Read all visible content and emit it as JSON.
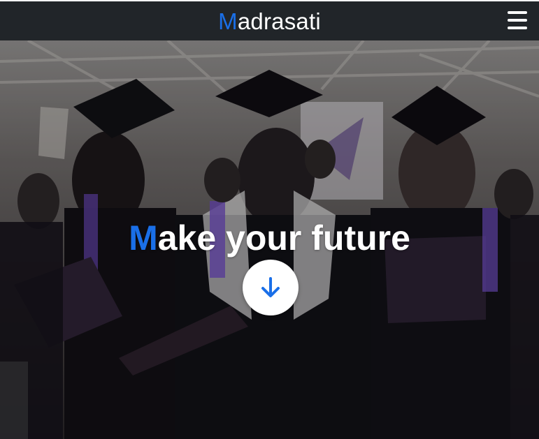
{
  "navbar": {
    "brand_initial": "M",
    "brand_rest": "adrasati",
    "menu_icon": "hamburger-menu-icon"
  },
  "hero": {
    "title_initial": "M",
    "title_rest": "ake your future",
    "scroll_icon": "arrow-down-icon"
  },
  "colors": {
    "accent": "#1a6fe8",
    "navbar_bg": "#212529",
    "text": "#ffffff"
  }
}
